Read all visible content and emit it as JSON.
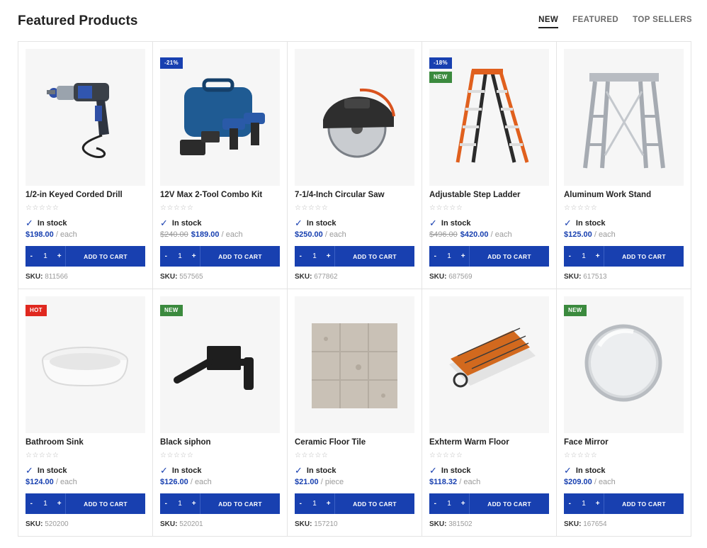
{
  "header": {
    "title": "Featured Products",
    "tabs": [
      {
        "label": "NEW",
        "active": true
      },
      {
        "label": "FEATURED",
        "active": false
      },
      {
        "label": "TOP SELLERS",
        "active": false
      }
    ]
  },
  "labels": {
    "in_stock": "In stock",
    "add_to_cart": "ADD TO CART",
    "sku_label": "SKU:",
    "minus": "-",
    "plus": "+",
    "quantity": "1",
    "stars": "☆☆☆☆☆"
  },
  "colors": {
    "accent": "#1840b0",
    "new_badge": "#3b8a3e",
    "hot_badge": "#e0281f"
  },
  "products": [
    {
      "name": "1/2-in Keyed Corded Drill",
      "price": "$198.00",
      "old_price": "",
      "unit": "/ each",
      "sku": "811566",
      "badges": [],
      "image": "drill"
    },
    {
      "name": "12V Max 2-Tool Combo Kit",
      "price": "$189.00",
      "old_price": "$240.00",
      "unit": "/ each",
      "sku": "557565",
      "badges": [
        {
          "text": "-21%",
          "type": "sale"
        }
      ],
      "image": "combo-kit"
    },
    {
      "name": "7-1/4-Inch Circular Saw",
      "price": "$250.00",
      "old_price": "",
      "unit": "/ each",
      "sku": "677862",
      "badges": [],
      "image": "circular-saw"
    },
    {
      "name": "Adjustable Step Ladder",
      "price": "$420.00",
      "old_price": "$496.00",
      "unit": "/ each",
      "sku": "687569",
      "badges": [
        {
          "text": "-18%",
          "type": "sale"
        },
        {
          "text": "NEW",
          "type": "new"
        }
      ],
      "image": "step-ladder"
    },
    {
      "name": "Aluminum Work Stand",
      "price": "$125.00",
      "old_price": "",
      "unit": "/ each",
      "sku": "617513",
      "badges": [],
      "image": "work-stand"
    },
    {
      "name": "Bathroom Sink",
      "price": "$124.00",
      "old_price": "",
      "unit": "/ each",
      "sku": "520200",
      "badges": [
        {
          "text": "HOT",
          "type": "hot"
        }
      ],
      "image": "sink"
    },
    {
      "name": "Black siphon",
      "price": "$126.00",
      "old_price": "",
      "unit": "/ each",
      "sku": "520201",
      "badges": [
        {
          "text": "NEW",
          "type": "new"
        }
      ],
      "image": "faucet"
    },
    {
      "name": "Ceramic Floor Tile",
      "price": "$21.00",
      "old_price": "",
      "unit": "/ piece",
      "sku": "157210",
      "badges": [],
      "image": "tile"
    },
    {
      "name": "Exhterm Warm Floor",
      "price": "$118.32",
      "old_price": "",
      "unit": "/ each",
      "sku": "381502",
      "badges": [],
      "image": "warm-floor"
    },
    {
      "name": "Face Mirror",
      "price": "$209.00",
      "old_price": "",
      "unit": "/ each",
      "sku": "167654",
      "badges": [
        {
          "text": "NEW",
          "type": "new"
        }
      ],
      "image": "mirror"
    }
  ]
}
